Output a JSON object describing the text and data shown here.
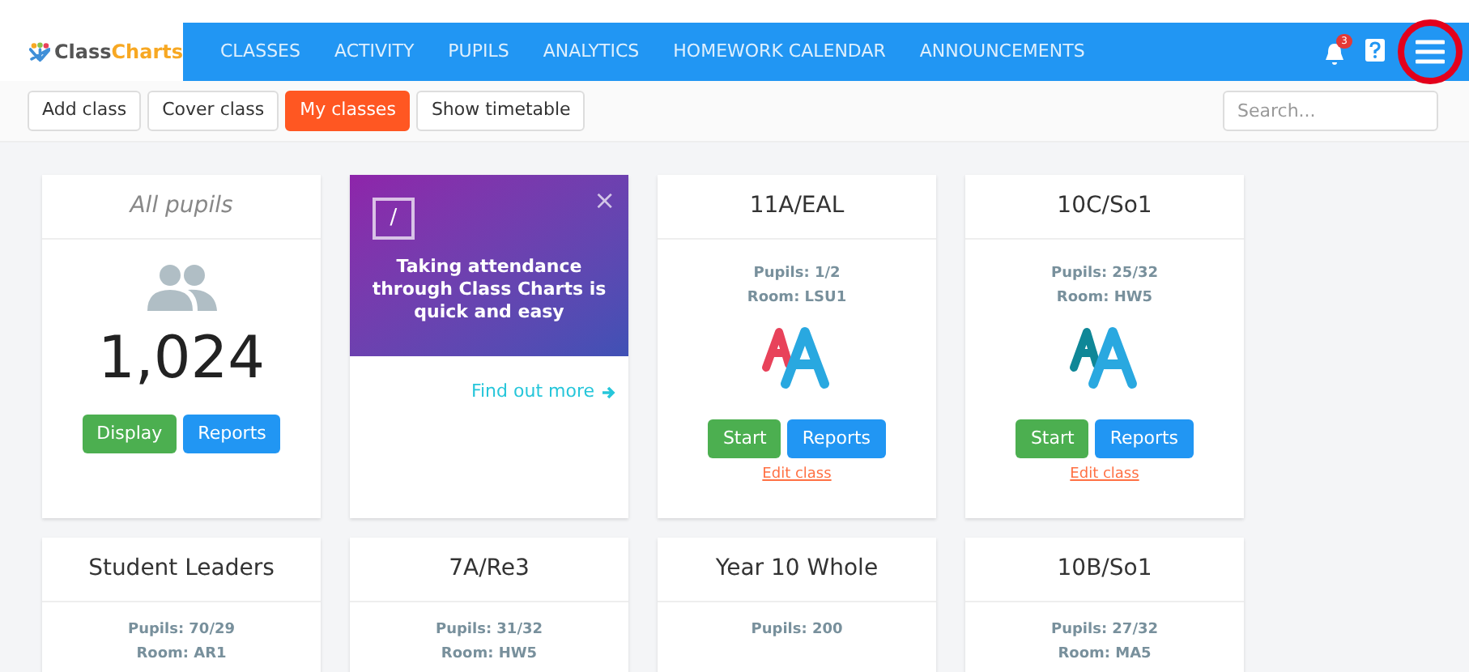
{
  "logo": {
    "text_1": "Class",
    "text_2": "Charts"
  },
  "nav": [
    "CLASSES",
    "ACTIVITY",
    "PUPILS",
    "ANALYTICS",
    "HOMEWORK CALENDAR",
    "ANNOUNCEMENTS"
  ],
  "notifications": {
    "count": "3"
  },
  "toolbar": [
    {
      "label": "Add class",
      "selected": false
    },
    {
      "label": "Cover class",
      "selected": false
    },
    {
      "label": "My classes",
      "selected": true
    },
    {
      "label": "Show timetable",
      "selected": false
    }
  ],
  "search": {
    "placeholder": "Search..."
  },
  "cards": [
    {
      "kind": "summary",
      "title": "All pupils",
      "count": "1,024",
      "buttons": [
        "Display",
        "Reports"
      ]
    },
    {
      "kind": "promo",
      "icon": "/",
      "close": "×",
      "text": "Taking attendance through Class Charts is quick and easy",
      "link": "Find out more"
    },
    {
      "kind": "class",
      "title": "11A/EAL",
      "pupils": "Pupils: 1/2",
      "room": "Room: LSU1",
      "color": "#e8425a",
      "buttons": [
        "Start",
        "Reports"
      ],
      "edit": "Edit class"
    },
    {
      "kind": "class",
      "title": "10C/So1",
      "pupils": "Pupils: 25/32",
      "room": "Room: HW5",
      "color": "#0f8797",
      "buttons": [
        "Start",
        "Reports"
      ],
      "edit": "Edit class"
    },
    {
      "kind": "class",
      "title": "Student Leaders",
      "pupils": "Pupils: 70/29",
      "room": "Room: AR1"
    },
    {
      "kind": "class",
      "title": "7A/Re3",
      "pupils": "Pupils: 31/32",
      "room": "Room: HW5"
    },
    {
      "kind": "class",
      "title": "Year 10 Whole",
      "pupils": "Pupils: 200"
    },
    {
      "kind": "class",
      "title": "10B/So1",
      "pupils": "Pupils: 27/32",
      "room": "Room: MA5"
    }
  ]
}
